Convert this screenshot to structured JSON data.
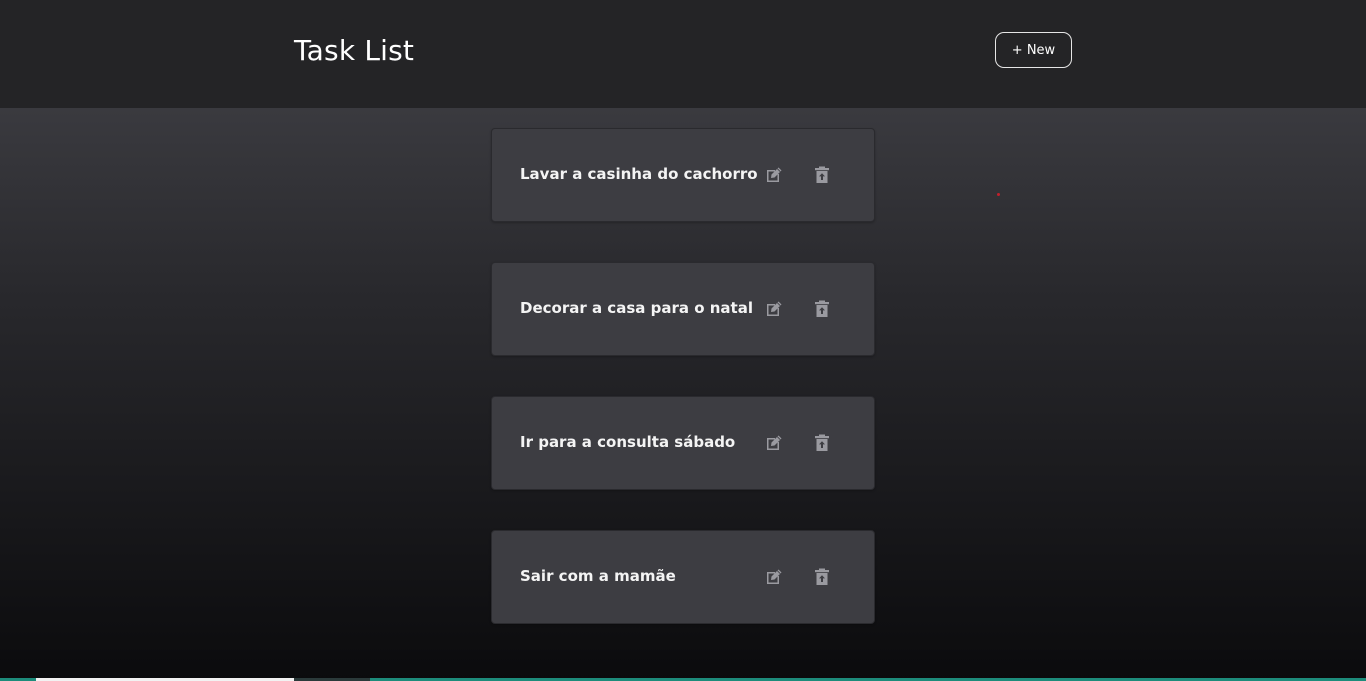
{
  "header": {
    "title": "Task List",
    "new_button_label": "+ New"
  },
  "tasks": [
    {
      "text": "Lavar a casinha do cachorro"
    },
    {
      "text": "Decorar a casa para o natal"
    },
    {
      "text": "Ir para a consulta sábado"
    },
    {
      "text": "Sair com a mamãe"
    }
  ],
  "icons": {
    "edit": "edit-icon",
    "delete": "trash-icon"
  },
  "colors": {
    "header_bg": "#242426",
    "card_bg": "#3d3d42",
    "icon": "#9a9aa0",
    "accent_dot": "#c21f2b"
  }
}
